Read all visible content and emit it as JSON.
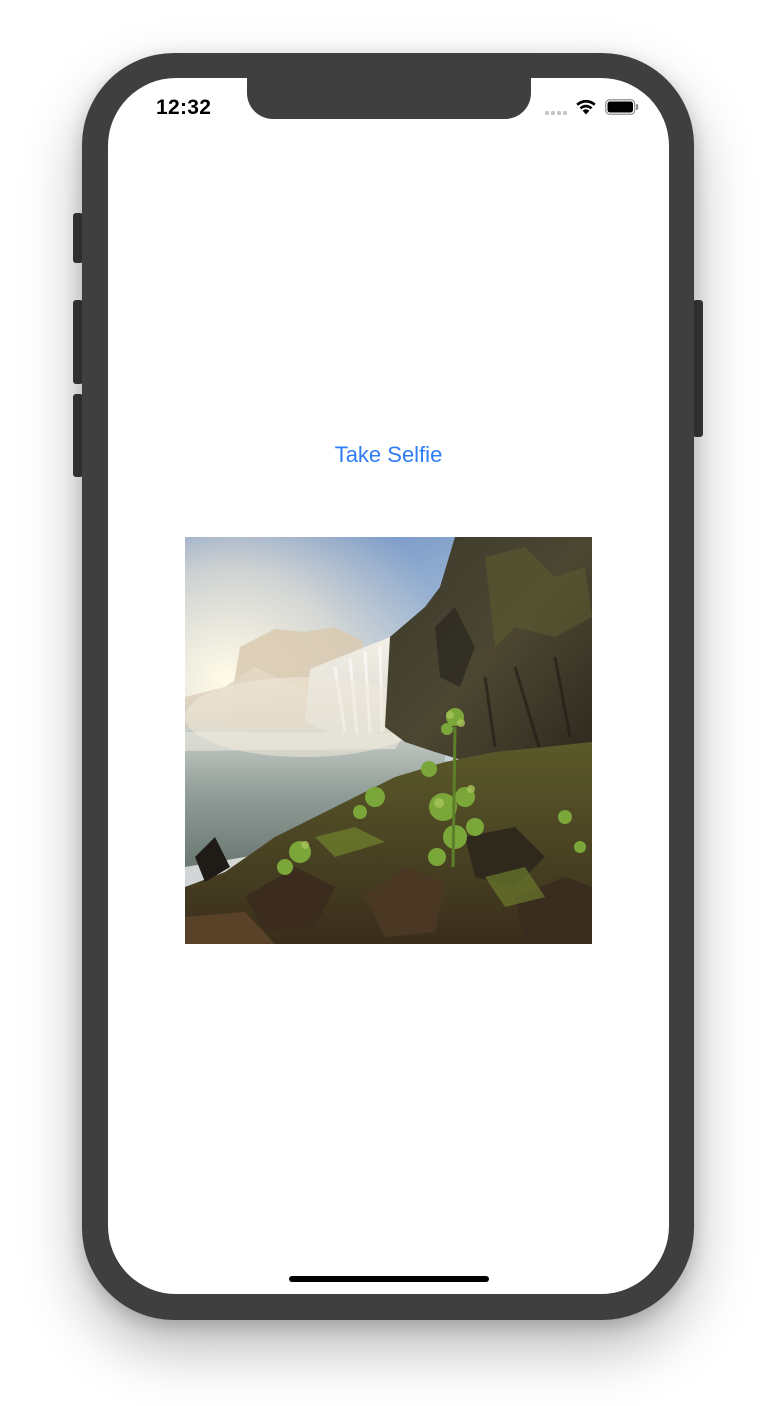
{
  "status_bar": {
    "time": "12:32",
    "signal_icon": "cellular-signal-icon",
    "wifi_icon": "wifi-icon",
    "battery_icon": "battery-icon"
  },
  "main": {
    "take_selfie_label": "Take Selfie",
    "photo": {
      "subject": "waterfall-landscape-image"
    }
  },
  "colors": {
    "accent": "#2f7cf6",
    "device_frame": "#3f3f3f",
    "screen_background": "#ffffff"
  }
}
